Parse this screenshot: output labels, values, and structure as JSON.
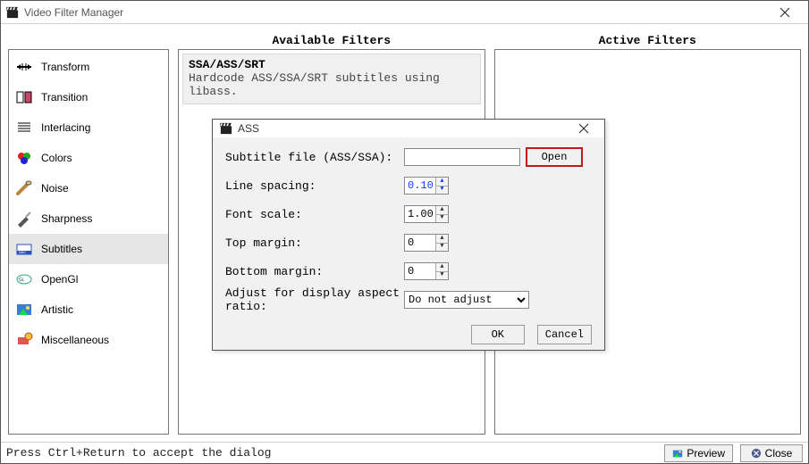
{
  "window": {
    "title": "Video Filter Manager"
  },
  "sidebar": {
    "items": [
      {
        "label": "Transform"
      },
      {
        "label": "Transition"
      },
      {
        "label": "Interlacing"
      },
      {
        "label": "Colors"
      },
      {
        "label": "Noise"
      },
      {
        "label": "Sharpness"
      },
      {
        "label": "Subtitles"
      },
      {
        "label": "OpenGl"
      },
      {
        "label": "Artistic"
      },
      {
        "label": "Miscellaneous"
      }
    ],
    "selected_index": 6
  },
  "headers": {
    "available": "Available Filters",
    "active": "Active Filters"
  },
  "available": {
    "items": [
      {
        "name": "SSA/ASS/SRT",
        "desc": "Hardcode ASS/SSA/SRT subtitles using libass."
      }
    ]
  },
  "dialog": {
    "title": "ASS",
    "fields": {
      "subtitle_label": "Subtitle file (ASS/SSA):",
      "subtitle_value": "",
      "open_label": "Open",
      "line_spacing_label": "Line spacing:",
      "line_spacing_value": "0.10",
      "font_scale_label": "Font scale:",
      "font_scale_value": "1.00",
      "top_margin_label": "Top margin:",
      "top_margin_value": "0",
      "bottom_margin_label": "Bottom margin:",
      "bottom_margin_value": "0",
      "aspect_label": "Adjust for display aspect ratio:",
      "aspect_value": "Do not adjust"
    },
    "ok_label": "OK",
    "cancel_label": "Cancel"
  },
  "footer": {
    "hint": "Press Ctrl+Return to accept the dialog",
    "preview": "Preview",
    "close": "Close"
  }
}
